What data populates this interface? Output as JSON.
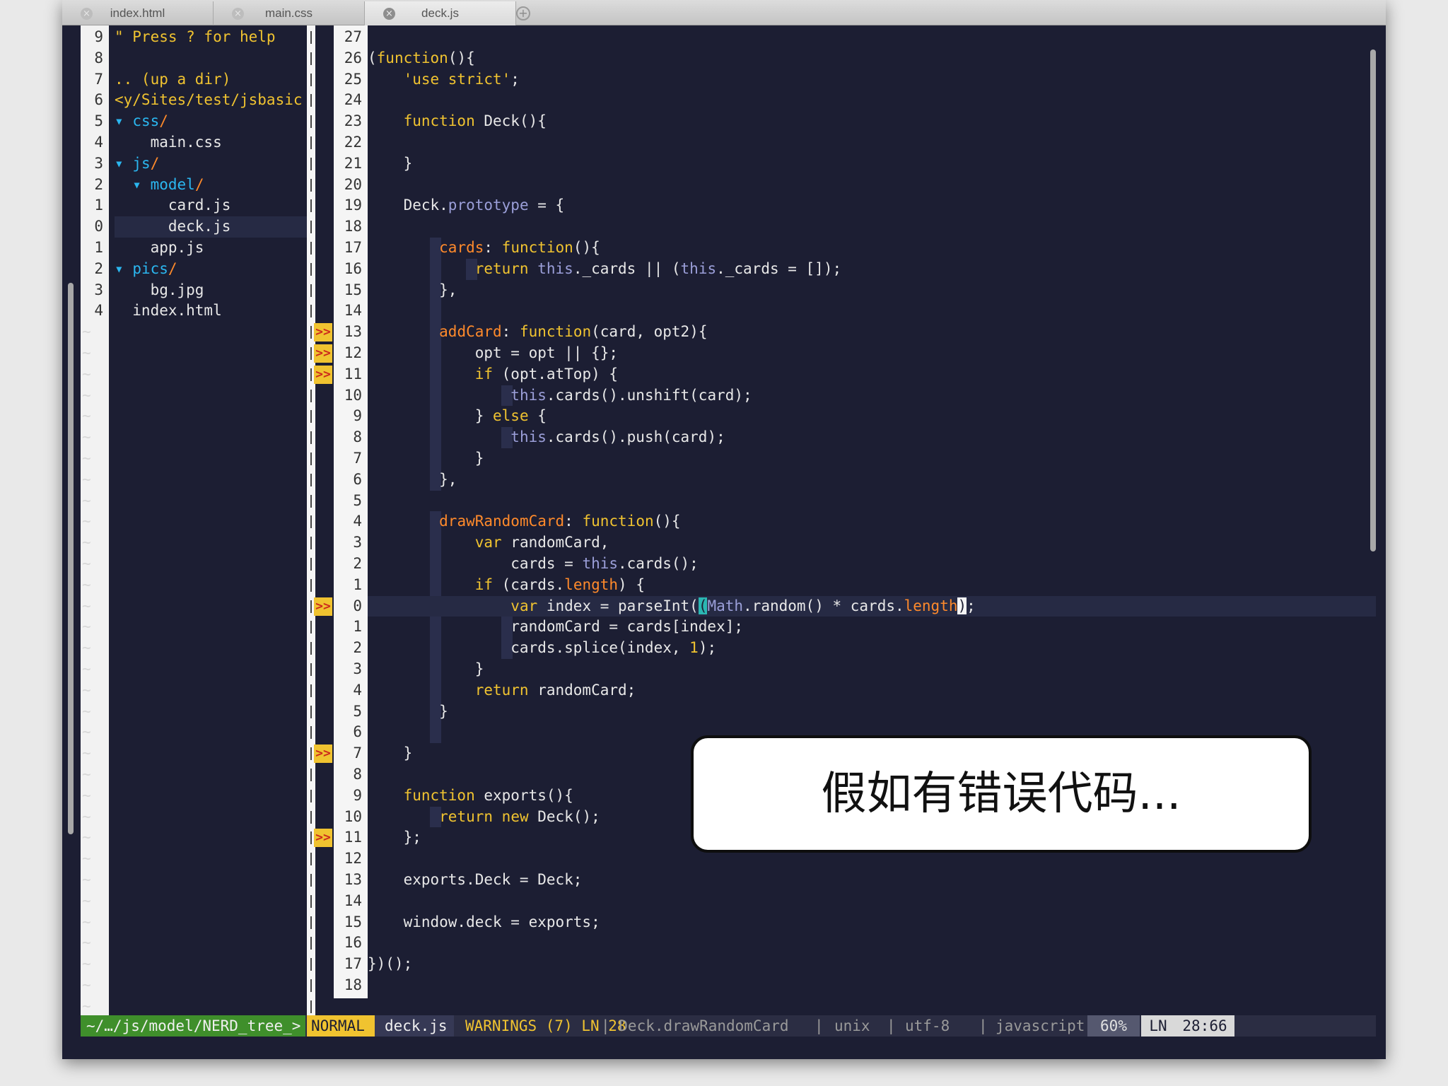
{
  "tabs": [
    {
      "label": "index.html",
      "active": false
    },
    {
      "label": "main.css",
      "active": false
    },
    {
      "label": "deck.js",
      "active": true
    }
  ],
  "icons": {
    "close": "close-icon",
    "add": "plus-icon",
    "sign": "warning-sign-icon"
  },
  "nerdtree": {
    "lines": [
      {
        "ln": "9",
        "text": "\" Press ? for help",
        "type": "help"
      },
      {
        "ln": "8",
        "text": "",
        "type": "blank"
      },
      {
        "ln": "7",
        "text": ".. (up a dir)",
        "type": "updir"
      },
      {
        "ln": "6",
        "text": "<y/Sites/test/jsbasic",
        "type": "root"
      },
      {
        "ln": "5",
        "text": "▾ css/",
        "type": "dir"
      },
      {
        "ln": "4",
        "text": "    main.css",
        "type": "file"
      },
      {
        "ln": "3",
        "text": "▾ js/",
        "type": "dir"
      },
      {
        "ln": "2",
        "text": "  ▾ model/",
        "type": "dir"
      },
      {
        "ln": "1",
        "text": "      card.js",
        "type": "file"
      },
      {
        "ln": "0",
        "text": "      deck.js",
        "type": "file",
        "current": true
      },
      {
        "ln": "1",
        "text": "    app.js",
        "type": "file"
      },
      {
        "ln": "2",
        "text": "▾ pics/",
        "type": "dir"
      },
      {
        "ln": "3",
        "text": "    bg.jpg",
        "type": "file"
      },
      {
        "ln": "4",
        "text": "  index.html",
        "type": "file"
      }
    ]
  },
  "gutter": {
    "numbers": [
      "27",
      "26",
      "25",
      "24",
      "23",
      "22",
      "21",
      "20",
      "19",
      "18",
      "17",
      "16",
      "15",
      "14",
      "13",
      "12",
      "11",
      "10",
      "9",
      "8",
      "7",
      "6",
      "5",
      "4",
      "3",
      "2",
      "1",
      "0",
      "1",
      "2",
      "3",
      "4",
      "5",
      "6",
      "7",
      "8",
      "9",
      "10",
      "11",
      "12",
      "13",
      "14",
      "15",
      "16",
      "17",
      "18"
    ],
    "signs": [
      14,
      15,
      16,
      27,
      34,
      38
    ],
    "sign_text": ">>"
  },
  "code_lines": [
    "",
    "(function(){",
    "    'use strict';",
    "",
    "    function Deck(){",
    "",
    "    }",
    "",
    "    Deck.prototype = {",
    "",
    "        cards: function(){",
    "            return this._cards || (this._cards = []);",
    "        },",
    "",
    "        addCard: function(card, opt2){",
    "            opt = opt || {};",
    "            if (opt.atTop) {",
    "                this.cards().unshift(card);",
    "            } else {",
    "                this.cards().push(card);",
    "            }",
    "        },",
    "",
    "        drawRandomCard: function(){",
    "            var randomCard,",
    "                cards = this.cards();",
    "            if (cards.length) {",
    "                var index = parseInt(Math.random() * cards.length);",
    "                randomCard = cards[index];",
    "                cards.splice(index, 1);",
    "            }",
    "            return randomCard;",
    "        }",
    "",
    "    }",
    "",
    "    function exports(){",
    "        return new Deck();",
    "    };",
    "",
    "    exports.Deck = Deck;",
    "",
    "    window.deck = exports;",
    "",
    "})();",
    ""
  ],
  "cursor_line_index": 27,
  "statusline": {
    "tree": "~/…/js/model/NERD_tree_>",
    "mode": "NORMAL",
    "file": "deck.js",
    "warnings": "WARNINGS (7) LN 28",
    "function": "| Deck.drawRandomCard",
    "sep": "|",
    "fileformat": "unix",
    "encoding": "utf-8",
    "filetype": "javascript",
    "percent": "60%",
    "ln_label": "LN",
    "position": "28:66"
  },
  "caption": "假如有错误代码...",
  "colors": {
    "background": "#1c1e33",
    "keyword": "#f0c330",
    "property": "#ff8a2b",
    "this": "#9b9fd9",
    "mode_bg": "#f0c330",
    "tree_bg": "#3f8f2b"
  }
}
